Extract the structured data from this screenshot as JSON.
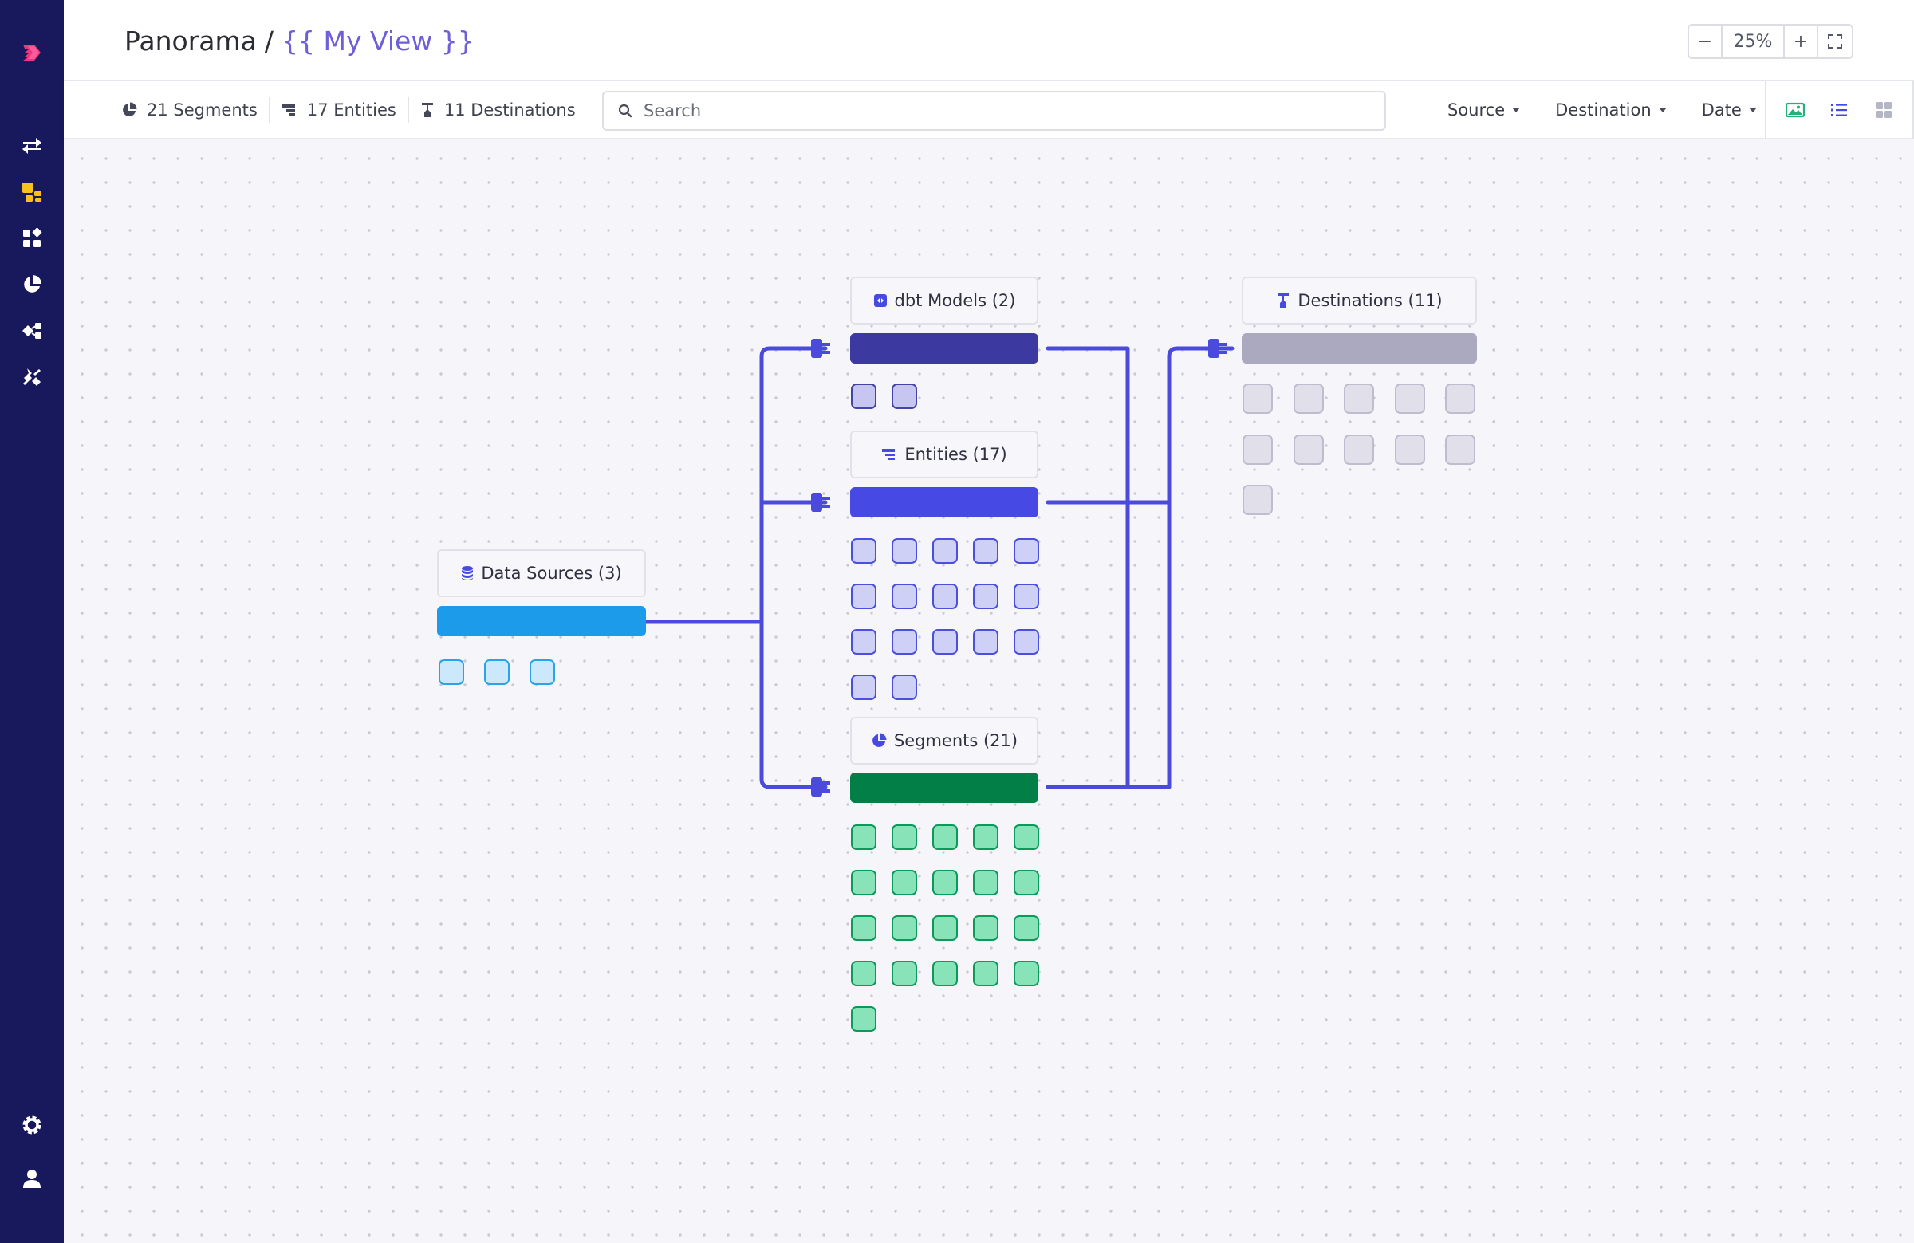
{
  "header": {
    "root": "Panorama",
    "separator": "/",
    "view_name": "{{ My View }}",
    "zoom": {
      "minus": "−",
      "value": "25%",
      "plus": "+"
    }
  },
  "toolbar": {
    "stats": [
      {
        "icon": "pie-chart-icon",
        "label": "21 Segments"
      },
      {
        "icon": "entity-icon",
        "label": "17 Entities"
      },
      {
        "icon": "destination-icon",
        "label": "11 Destinations"
      }
    ],
    "search_placeholder": "Search",
    "filters": [
      {
        "label": "Source"
      },
      {
        "label": "Destination"
      },
      {
        "label": "Date"
      }
    ],
    "view_modes": [
      "image-view-icon",
      "list-view-icon",
      "grid-view-icon"
    ]
  },
  "nav": {
    "items": [
      "logo-icon",
      "sync-icon",
      "models-icon",
      "apps-icon",
      "segments-icon",
      "audiences-icon",
      "integrations-icon",
      "settings-icon",
      "user-icon"
    ]
  },
  "graph": {
    "data_sources": {
      "label": "Data Sources (3)",
      "count": 3,
      "bar_color": "#1b9bea",
      "cell_fill": "#cce9fb",
      "cell_border": "#2aa3ea"
    },
    "dbt_models": {
      "label": "dbt Models (2)",
      "count": 2,
      "bar_color": "#3c3aa0",
      "cell_fill": "#c7c6f1",
      "cell_border": "#4444a4"
    },
    "entities": {
      "label": "Entities (17)",
      "count": 17,
      "bar_color": "#4649e4",
      "cell_fill": "#cfd0f6",
      "cell_border": "#4a4fdc"
    },
    "segments": {
      "label": "Segments (21)",
      "count": 21,
      "bar_color": "#027f47",
      "cell_fill": "#89e3b8",
      "cell_border": "#0c9a5b"
    },
    "destinations": {
      "label": "Destinations (11)",
      "count": 11,
      "bar_color": "#aba9bf",
      "cell_fill": "#e1e0ea",
      "cell_border": "#bebdd0"
    },
    "wire_color": "#4a4bdb"
  }
}
